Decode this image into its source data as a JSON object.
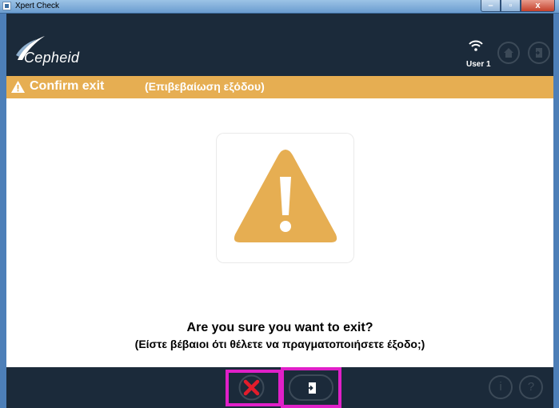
{
  "window": {
    "title": "Xpert Check"
  },
  "header": {
    "logo_text": "Cepheid",
    "user": "User 1"
  },
  "banner": {
    "title": "Confirm exit",
    "subtitle": "(Επιβεβαίωση εξόδου)"
  },
  "dialog": {
    "question_en": "Are you sure you want to exit?",
    "question_el": "(Είστε βέβαιοι ότι θέλετε να πραγματοποιήσετε έξοδο;)"
  },
  "footer": {
    "info_label": "i",
    "help_label": "?"
  },
  "colors": {
    "header_bg": "#1b2a3a",
    "banner": "#e6ae52",
    "warning": "#e6ae52",
    "cancel": "#e21c2b",
    "highlight": "#e020c8"
  },
  "icons": [
    "wifi-icon",
    "home-icon",
    "exit-icon",
    "warning-icon",
    "cancel-icon",
    "info-icon",
    "help-icon"
  ]
}
